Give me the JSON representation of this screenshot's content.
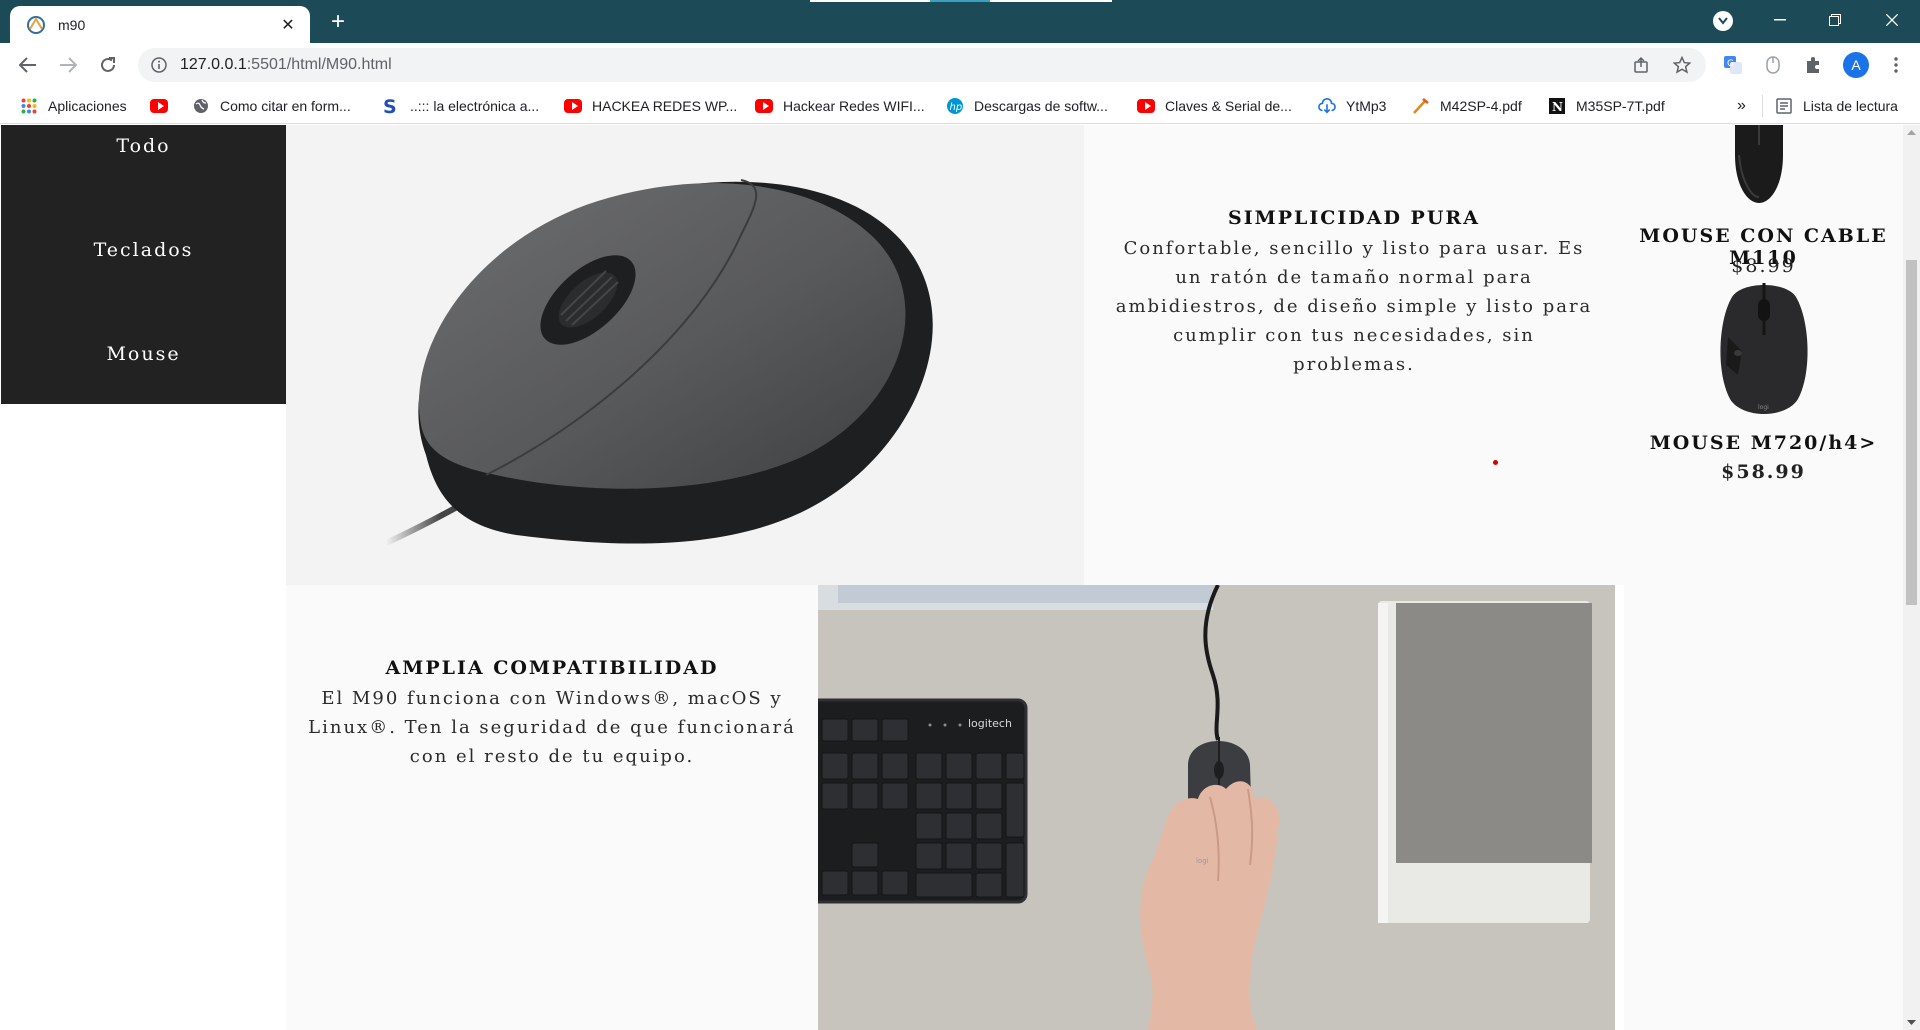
{
  "browser": {
    "tab": {
      "title": "m90",
      "favicon": "vscode-live-icon"
    },
    "address": {
      "host": "127.0.0.1",
      "path": ":5501/html/M90.html"
    },
    "profile_initial": "A",
    "bookmarks": [
      {
        "label": "Aplicaciones",
        "icon": "apps-grid-icon"
      },
      {
        "label": "",
        "icon": "youtube-icon"
      },
      {
        "label": "Como citar en form...",
        "icon": "globe-icon"
      },
      {
        "label": "..::: la electrónica a...",
        "icon": "s-logo-icon"
      },
      {
        "label": "HACKEA REDES WP...",
        "icon": "youtube-icon"
      },
      {
        "label": "Hackear Redes WIFI...",
        "icon": "youtube-icon"
      },
      {
        "label": "Descargas de softw...",
        "icon": "hp-icon"
      },
      {
        "label": "Claves & Serial de...",
        "icon": "youtube-icon"
      },
      {
        "label": "YtMp3",
        "icon": "cloud-download-icon"
      },
      {
        "label": "M42SP-4.pdf",
        "icon": "pdf-tool-icon"
      },
      {
        "label": "M35SP-7T.pdf",
        "icon": "notion-icon"
      }
    ],
    "overflow": "»",
    "reading_list": "Lista de lectura"
  },
  "sidebar": {
    "items": [
      {
        "label": "Todo"
      },
      {
        "label": "Teclados"
      },
      {
        "label": "Mouse"
      }
    ]
  },
  "section1": {
    "title": "SIMPLICIDAD PURA",
    "body_lines": [
      "Confortable, sencillo y listo para usar. Es",
      "un ratón de tamaño normal para",
      "ambidiestros, de diseño simple y listo para",
      "cumplir con tus necesidades, sin",
      "problemas."
    ]
  },
  "section2": {
    "title": "AMPLIA COMPATIBILIDAD",
    "body_lines": [
      "El M90 funciona con Windows®, macOS y",
      "Linux®. Ten la seguridad de que funcionará",
      "con el resto de tu equipo."
    ]
  },
  "related": [
    {
      "name": "MOUSE CON CABLE M110",
      "price": "$8.99"
    },
    {
      "name": "MOUSE M720/h4>",
      "price": "$58.99"
    }
  ],
  "keyboard_brand": "logitech",
  "mouse_brand": "logi",
  "colors": {
    "chrome_tab_bar": "#1d4a57",
    "sidebar": "#222222",
    "accent_dot": "#d40000"
  }
}
